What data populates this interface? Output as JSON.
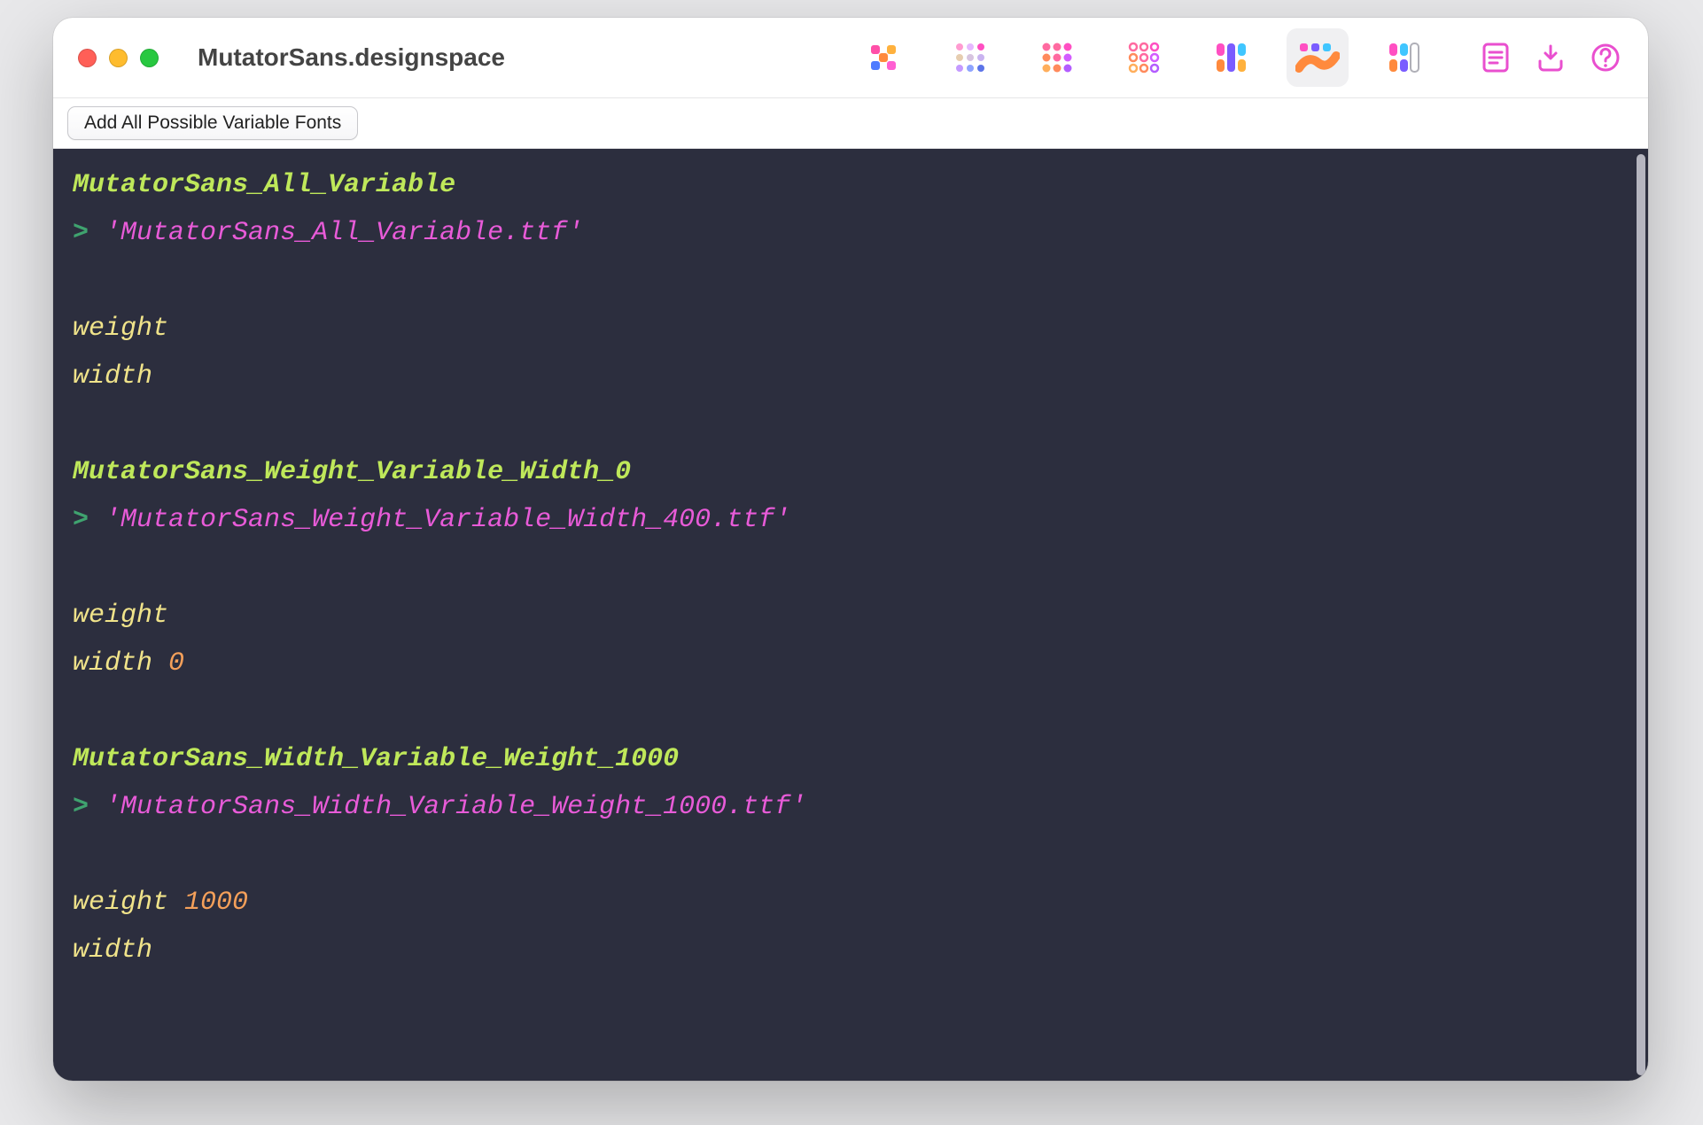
{
  "window": {
    "title": "MutatorSans.designspace"
  },
  "toolbar": {
    "add_button_label": "Add All Possible Variable Fonts"
  },
  "tabs": {
    "selected_index": 5,
    "icons": [
      "cross-icon",
      "grid-light-icon",
      "grid-solid-icon",
      "grid-ring-icon",
      "bars-icon",
      "swoosh-icon",
      "swatch-icon"
    ]
  },
  "right_icons": [
    "document-icon",
    "download-icon",
    "help-icon"
  ],
  "fonts": [
    {
      "name": "MutatorSans_All_Variable",
      "output_file": "'MutatorSans_All_Variable.ttf'",
      "axes": [
        {
          "label": "weight",
          "value": ""
        },
        {
          "label": "width",
          "value": ""
        }
      ]
    },
    {
      "name": "MutatorSans_Weight_Variable_Width_0",
      "output_file": "'MutatorSans_Weight_Variable_Width_400.ttf'",
      "axes": [
        {
          "label": "weight",
          "value": ""
        },
        {
          "label": "width",
          "value": "0"
        }
      ]
    },
    {
      "name": "MutatorSans_Width_Variable_Weight_1000",
      "output_file": "'MutatorSans_Width_Variable_Weight_1000.ttf'",
      "axes": [
        {
          "label": "weight",
          "value": "1000"
        },
        {
          "label": "width",
          "value": ""
        }
      ]
    }
  ],
  "colors": {
    "terminal_bg": "#2c2e3e",
    "heading": "#bfe85a",
    "axis": "#f0e38a",
    "string": "#e85bd8",
    "number": "#f5a05a",
    "arrow": "#3fa36f",
    "accent_pink": "#e94fcf"
  }
}
